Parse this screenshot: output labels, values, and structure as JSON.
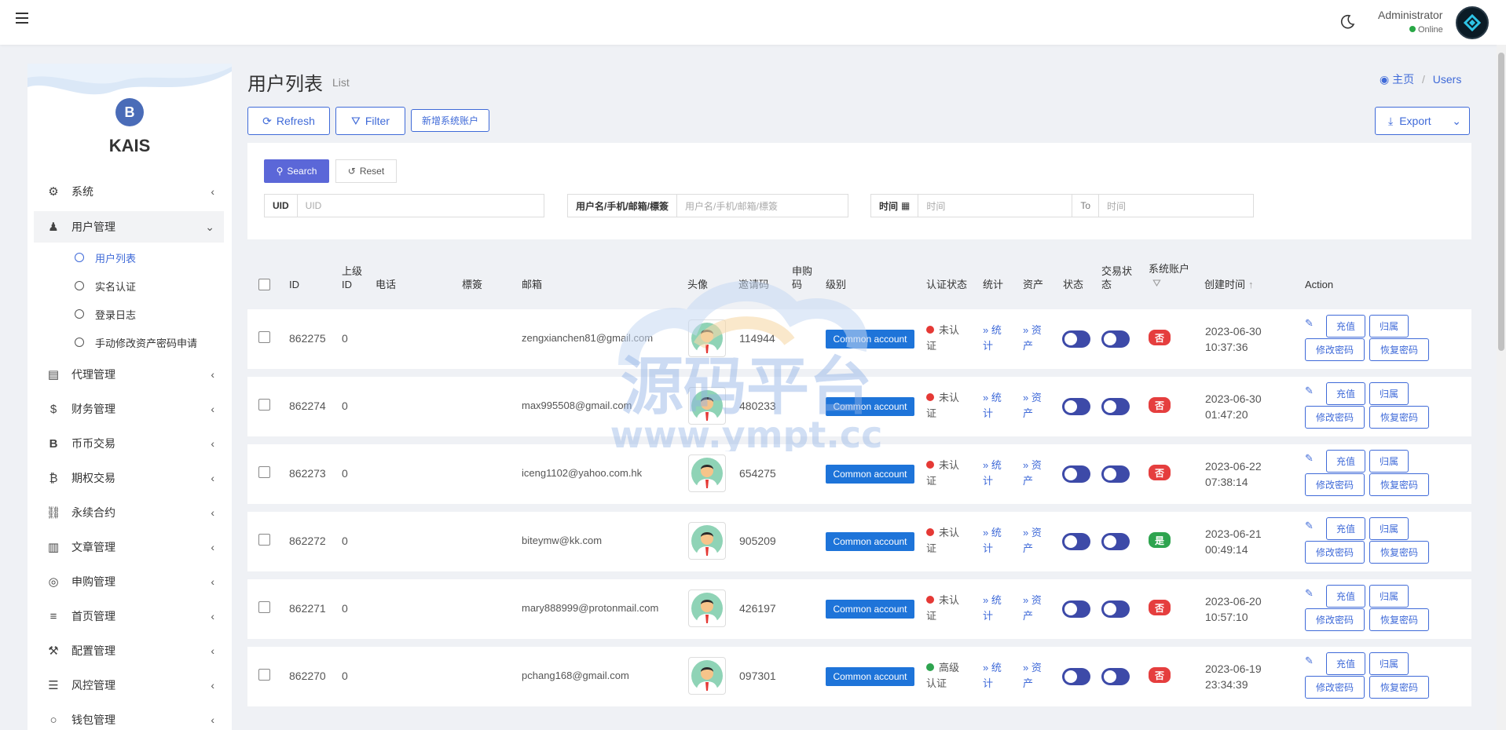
{
  "topbar": {
    "admin_name": "Administrator",
    "status": "Online"
  },
  "sidebar": {
    "brand": "KAIS",
    "logo_glyph": "B",
    "menu": [
      {
        "label": "系统",
        "icon": "gear-icon",
        "glyph": "⚙"
      },
      {
        "label": "用户管理",
        "icon": "user-icon",
        "glyph": "👤"
      },
      {
        "label": "代理管理",
        "icon": "id-card-icon",
        "glyph": "▤"
      },
      {
        "label": "财务管理",
        "icon": "dollar-icon",
        "glyph": "$"
      },
      {
        "label": "币币交易",
        "icon": "bitcoin-b-icon",
        "glyph": "B"
      },
      {
        "label": "期权交易",
        "icon": "bitcoin-icon",
        "glyph": "₿"
      },
      {
        "label": "永续合约",
        "icon": "link-icon",
        "glyph": "⛓"
      },
      {
        "label": "文章管理",
        "icon": "newspaper-icon",
        "glyph": "▥"
      },
      {
        "label": "申购管理",
        "icon": "lifebuoy-icon",
        "glyph": "◎"
      },
      {
        "label": "首页管理",
        "icon": "list-icon",
        "glyph": "≡"
      },
      {
        "label": "配置管理",
        "icon": "wrench-icon",
        "glyph": "🔧"
      },
      {
        "label": "风控管理",
        "icon": "list-indent-icon",
        "glyph": "☰"
      },
      {
        "label": "钱包管理",
        "icon": "circle-icon",
        "glyph": "○"
      }
    ],
    "submenu": [
      "用户列表",
      "实名认证",
      "登录日志",
      "手动修改资产密码申请"
    ]
  },
  "header": {
    "title": "用户列表",
    "subtitle": "List",
    "breadcrumb_home": "主页",
    "breadcrumb_current": "Users"
  },
  "toolbar": {
    "refresh": "Refresh",
    "filter": "Filter",
    "add_system": "新增系统账户",
    "export": "Export"
  },
  "filters": {
    "search": "Search",
    "reset": "Reset",
    "uid_label": "UID",
    "uid_placeholder": "UID",
    "name_label": "用户名/手机/邮箱/標簽",
    "name_placeholder": "用户名/手机/邮箱/標簽",
    "time_label": "时间",
    "time_placeholder": "时间",
    "to_label": "To",
    "to_placeholder": "时间"
  },
  "table": {
    "headers": {
      "id": "ID",
      "parent": "上级ID",
      "phone": "电话",
      "tag": "標簽",
      "email": "邮箱",
      "avatar": "头像",
      "invite": "邀请码",
      "subscribe": "申购码",
      "level": "级别",
      "auth": "认证状态",
      "stats": "统计",
      "assets": "资产",
      "status": "状态",
      "trade": "交易状态",
      "system": "系统账户",
      "created": "创建时间",
      "action": "Action"
    },
    "rows": [
      {
        "id": "862275",
        "parent": "0",
        "email": "zengxianchen81@gmail.com",
        "invite": "114944",
        "level": "Common account",
        "auth": "未认证",
        "auth_color": "#e53935",
        "stats": "» 统计",
        "assets": "» 资产",
        "system": "否",
        "system_color": "#e53e3e",
        "created_date": "2023-06-30",
        "created_time": "10:37:36"
      },
      {
        "id": "862274",
        "parent": "0",
        "email": "max995508@gmail.com",
        "invite": "480233",
        "level": "Common account",
        "auth": "未认证",
        "auth_color": "#e53935",
        "stats": "» 统计",
        "assets": "» 资产",
        "system": "否",
        "system_color": "#e53e3e",
        "created_date": "2023-06-30",
        "created_time": "01:47:20"
      },
      {
        "id": "862273",
        "parent": "0",
        "email": "iceng1102@yahoo.com.hk",
        "invite": "654275",
        "level": "Common account",
        "auth": "未认证",
        "auth_color": "#e53935",
        "stats": "» 统计",
        "assets": "» 资产",
        "system": "否",
        "system_color": "#e53e3e",
        "created_date": "2023-06-22",
        "created_time": "07:38:14"
      },
      {
        "id": "862272",
        "parent": "0",
        "email": "biteymw@kk.com",
        "invite": "905209",
        "level": "Common account",
        "auth": "未认证",
        "auth_color": "#e53935",
        "stats": "» 统计",
        "assets": "» 资产",
        "system": "是",
        "system_color": "#2ea44f",
        "created_date": "2023-06-21",
        "created_time": "00:49:14"
      },
      {
        "id": "862271",
        "parent": "0",
        "email": "mary888999@protonmail.com",
        "invite": "426197",
        "level": "Common account",
        "auth": "未认证",
        "auth_color": "#e53935",
        "stats": "» 统计",
        "assets": "» 资产",
        "system": "否",
        "system_color": "#e53e3e",
        "created_date": "2023-06-20",
        "created_time": "10:57:10"
      },
      {
        "id": "862270",
        "parent": "0",
        "email": "pchang168@gmail.com",
        "invite": "097301",
        "level": "Common account",
        "auth": "高级认证",
        "auth_color": "#2ea44f",
        "stats": "» 统计",
        "assets": "» 资产",
        "system": "否",
        "system_color": "#e53e3e",
        "created_date": "2023-06-19",
        "created_time": "23:34:39"
      }
    ],
    "action_labels": {
      "recharge": "充值",
      "owner": "归属",
      "change_pwd": "修改密码",
      "reset_pwd": "恢复密码"
    }
  },
  "watermark": {
    "title": "源码平台",
    "url": "www.ympt.cc"
  },
  "colors": {
    "primary": "#3f6ad8",
    "search_btn": "#5b67d8",
    "level_badge": "#1e74d9",
    "toggle": "#3d4aa8"
  }
}
